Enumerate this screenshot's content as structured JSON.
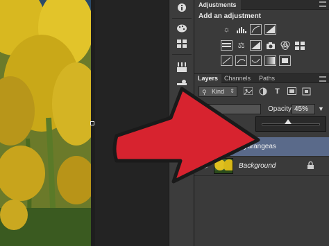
{
  "adjustments": {
    "tab_label": "Adjustments",
    "title": "Add an adjustment",
    "row1_icons": [
      "brightness-icon",
      "levels-icon",
      "curves-icon",
      "exposure-icon"
    ],
    "row2_icons": [
      "vibrance-icon",
      "balance-icon",
      "black-white-icon",
      "photo-filter-icon",
      "channel-mixer-icon",
      "color-lookup-icon"
    ],
    "row3_icons": [
      "invert-icon",
      "posterize-icon",
      "threshold-icon",
      "gradient-map-icon",
      "selective-color-icon"
    ]
  },
  "layers_panel": {
    "tabs": [
      "Layers",
      "Channels",
      "Paths"
    ],
    "active_tab": "Layers",
    "filter_kind": "Kind",
    "blend_mode": "al",
    "opacity_label": "Opacity:",
    "opacity_value": "45%",
    "opacity_fraction": 0.45,
    "layers": [
      {
        "name": "Hydrangeas",
        "selected": true,
        "locked": false,
        "italic": false
      },
      {
        "name": "Background",
        "selected": false,
        "locked": true,
        "italic": true
      }
    ]
  },
  "colors": {
    "arrow_fill": "#d7232f",
    "arrow_stroke": "#1a1a1a",
    "selected_layer": "#5a6a8a"
  }
}
